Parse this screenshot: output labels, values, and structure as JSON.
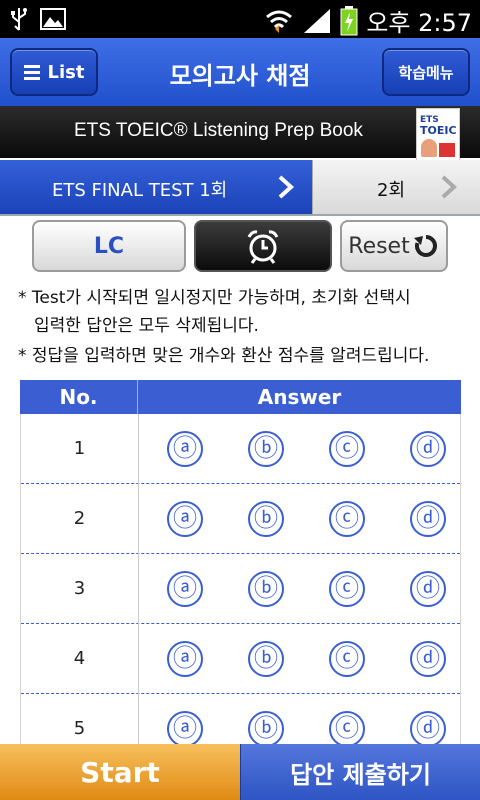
{
  "status_bar": {
    "time": "오후 2:57",
    "icons": [
      "usb-icon",
      "image-icon",
      "wifi-icon",
      "signal-icon",
      "battery-charging-icon"
    ]
  },
  "title_bar": {
    "list_label": "List",
    "title": "모의고사 채점",
    "menu_label": "학습메뉴"
  },
  "banner": {
    "text": "ETS TOEIC® Listening Prep Book",
    "book_line1": "ETS",
    "book_line2": "TOEIC"
  },
  "test_tabs": {
    "active_label": "ETS FINAL TEST 1회",
    "next_label": "2회"
  },
  "controls": {
    "lc_label": "LC",
    "timer_icon": "alarm-clock-icon",
    "reset_label": "Reset"
  },
  "notes": {
    "note1_line1": "* Test가 시작되면 일시정지만 가능하며, 초기화 선택시",
    "note1_line2": "입력한 답안은 모두 삭제됩니다.",
    "note2": "* 정답을 입력하면 맞은 개수와 환산 점수를 알려드립니다."
  },
  "table": {
    "col_no": "No.",
    "col_answer": "Answer",
    "options": [
      "ⓐ",
      "ⓑ",
      "ⓒ",
      "ⓓ"
    ],
    "rows": [
      "1",
      "2",
      "3",
      "4",
      "5"
    ]
  },
  "bottom": {
    "start_label": "Start",
    "submit_label": "답안 제출하기"
  },
  "colors": {
    "accent_blue": "#3b5fd3",
    "start_orange": "#e08a14"
  }
}
